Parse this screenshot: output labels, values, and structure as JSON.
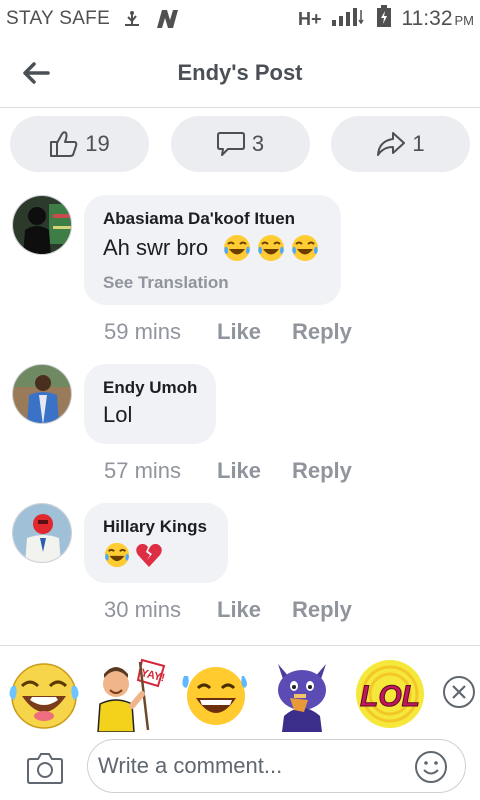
{
  "status_bar": {
    "carrier": "STAY SAFE",
    "network": "H+",
    "time": "11:32",
    "ampm": "PM"
  },
  "header": {
    "title": "Endy's Post"
  },
  "reactions": {
    "likes": "19",
    "comments": "3",
    "shares": "1"
  },
  "comments": [
    {
      "author": "Abasiama Da'koof Ituen",
      "text": "Ah swr bro",
      "emojis": [
        "laughing-tears",
        "laughing-tears",
        "laughing-tears"
      ],
      "see_translation": "See Translation",
      "time": "59 mins",
      "like": "Like",
      "reply": "Reply"
    },
    {
      "author": "Endy Umoh",
      "text": "Lol",
      "emojis": [],
      "time": "57 mins",
      "like": "Like",
      "reply": "Reply"
    },
    {
      "author": "Hillary Kings",
      "text": "",
      "emojis": [
        "laughing-tears",
        "broken-heart"
      ],
      "time": "30 mins",
      "like": "Like",
      "reply": "Reply"
    }
  ],
  "sticker_tray": {
    "stickers": [
      "laughing-face-sticker",
      "yay-flag-man-sticker",
      "grinning-sweat-sticker",
      "dog-eating-sticker",
      "lol-sticker"
    ],
    "lol_text": "LOL"
  },
  "composer": {
    "placeholder": "Write a comment..."
  },
  "colors": {
    "pill_bg": "#ebedf0",
    "bubble_bg": "#f0f2f5",
    "meta_gray": "#90949c",
    "header_text": "#4b4f56"
  }
}
